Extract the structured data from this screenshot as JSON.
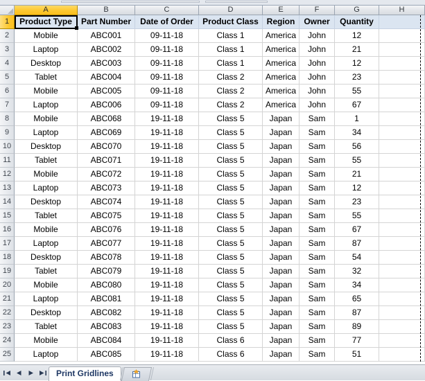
{
  "app": {
    "type": "spreadsheet",
    "active_cell": "A1",
    "colors": {
      "header_fill": "#DBE5F1",
      "active_header": "#FDC830",
      "gridline": "#D4D4D4",
      "tab_text": "#1F3864"
    }
  },
  "grid": {
    "column_letters": [
      "A",
      "B",
      "C",
      "D",
      "E",
      "F",
      "G",
      "H"
    ],
    "active_column": "A",
    "row_numbers": [
      1,
      2,
      3,
      4,
      5,
      6,
      7,
      8,
      9,
      10,
      11,
      12,
      13,
      14,
      15,
      16,
      17,
      18,
      19,
      20,
      21,
      22,
      23,
      24,
      25
    ],
    "active_row": 1,
    "headers": [
      "Product Type",
      "Part Number",
      "Date of Order",
      "Product Class",
      "Region",
      "Owner",
      "Quantity",
      ""
    ],
    "rows": [
      [
        "Mobile",
        "ABC001",
        "09-11-18",
        "Class 1",
        "America",
        "John",
        "12",
        ""
      ],
      [
        "Laptop",
        "ABC002",
        "09-11-18",
        "Class 1",
        "America",
        "John",
        "21",
        ""
      ],
      [
        "Desktop",
        "ABC003",
        "09-11-18",
        "Class 1",
        "America",
        "John",
        "12",
        ""
      ],
      [
        "Tablet",
        "ABC004",
        "09-11-18",
        "Class 2",
        "America",
        "John",
        "23",
        ""
      ],
      [
        "Mobile",
        "ABC005",
        "09-11-18",
        "Class 2",
        "America",
        "John",
        "55",
        ""
      ],
      [
        "Laptop",
        "ABC006",
        "09-11-18",
        "Class 2",
        "America",
        "John",
        "67",
        ""
      ],
      [
        "Mobile",
        "ABC068",
        "19-11-18",
        "Class 5",
        "Japan",
        "Sam",
        "1",
        ""
      ],
      [
        "Laptop",
        "ABC069",
        "19-11-18",
        "Class 5",
        "Japan",
        "Sam",
        "34",
        ""
      ],
      [
        "Desktop",
        "ABC070",
        "19-11-18",
        "Class 5",
        "Japan",
        "Sam",
        "56",
        ""
      ],
      [
        "Tablet",
        "ABC071",
        "19-11-18",
        "Class 5",
        "Japan",
        "Sam",
        "55",
        ""
      ],
      [
        "Mobile",
        "ABC072",
        "19-11-18",
        "Class 5",
        "Japan",
        "Sam",
        "21",
        ""
      ],
      [
        "Laptop",
        "ABC073",
        "19-11-18",
        "Class 5",
        "Japan",
        "Sam",
        "12",
        ""
      ],
      [
        "Desktop",
        "ABC074",
        "19-11-18",
        "Class 5",
        "Japan",
        "Sam",
        "23",
        ""
      ],
      [
        "Tablet",
        "ABC075",
        "19-11-18",
        "Class 5",
        "Japan",
        "Sam",
        "55",
        ""
      ],
      [
        "Mobile",
        "ABC076",
        "19-11-18",
        "Class 5",
        "Japan",
        "Sam",
        "67",
        ""
      ],
      [
        "Laptop",
        "ABC077",
        "19-11-18",
        "Class 5",
        "Japan",
        "Sam",
        "87",
        ""
      ],
      [
        "Desktop",
        "ABC078",
        "19-11-18",
        "Class 5",
        "Japan",
        "Sam",
        "54",
        ""
      ],
      [
        "Tablet",
        "ABC079",
        "19-11-18",
        "Class 5",
        "Japan",
        "Sam",
        "32",
        ""
      ],
      [
        "Mobile",
        "ABC080",
        "19-11-18",
        "Class 5",
        "Japan",
        "Sam",
        "34",
        ""
      ],
      [
        "Laptop",
        "ABC081",
        "19-11-18",
        "Class 5",
        "Japan",
        "Sam",
        "65",
        ""
      ],
      [
        "Desktop",
        "ABC082",
        "19-11-18",
        "Class 5",
        "Japan",
        "Sam",
        "87",
        ""
      ],
      [
        "Tablet",
        "ABC083",
        "19-11-18",
        "Class 5",
        "Japan",
        "Sam",
        "89",
        ""
      ],
      [
        "Mobile",
        "ABC084",
        "19-11-18",
        "Class 6",
        "Japan",
        "Sam",
        "77",
        ""
      ],
      [
        "Laptop",
        "ABC085",
        "19-11-18",
        "Class 6",
        "Japan",
        "Sam",
        "51",
        ""
      ]
    ]
  },
  "sheet_tabs": {
    "nav": {
      "first_label": "▌◀",
      "prev_label": "◀",
      "next_label": "▶",
      "last_label": "▶▌"
    },
    "tabs": [
      {
        "label": "Print Gridlines",
        "active": true
      }
    ],
    "insert_sheet_label": ""
  }
}
